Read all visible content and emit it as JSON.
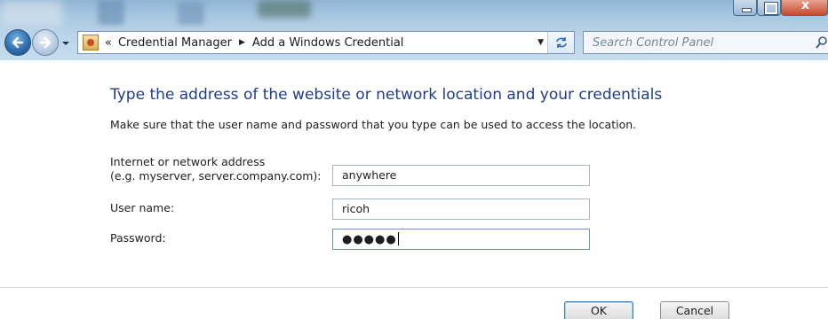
{
  "window": {
    "breadcrumb": {
      "overflow": "«",
      "items": [
        "Credential Manager",
        "Add a Windows Credential"
      ]
    },
    "search_placeholder": "Search Control Panel"
  },
  "content": {
    "heading": "Type the address of the website or network location and your credentials",
    "description": "Make sure that the user name and password that you type can be used to access the location.",
    "address_label_line1": "Internet or network address",
    "address_label_line2": "(e.g. myserver, server.company.com):",
    "address_value": "anywhere",
    "username_label": "User name:",
    "username_value": "ricoh",
    "password_label": "Password:",
    "password_mask": "●●●●●"
  },
  "buttons": {
    "ok": "OK",
    "cancel": "Cancel"
  },
  "colors": {
    "heading": "#1e3d8a",
    "glass": "#bcd5ea",
    "focus_border": "#6f95c5"
  }
}
